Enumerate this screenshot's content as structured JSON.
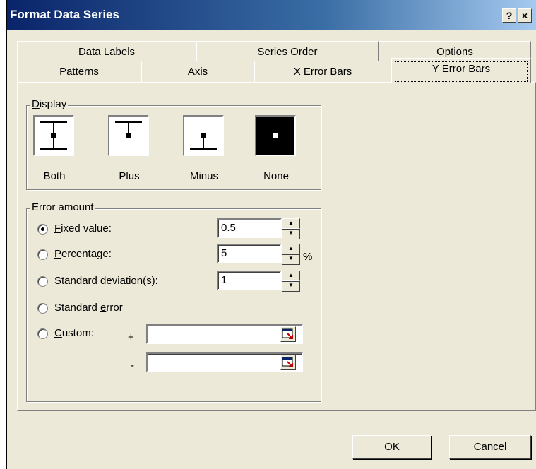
{
  "window": {
    "title": "Format Data Series",
    "help_glyph": "?",
    "close_glyph": "×"
  },
  "tabs": {
    "back_row": [
      "Data Labels",
      "Series Order",
      "Options"
    ],
    "front_row": [
      "Patterns",
      "Axis",
      "X Error Bars",
      "Y Error Bars"
    ],
    "active": "Y Error Bars"
  },
  "display": {
    "legend": "Display",
    "options": [
      {
        "label": "Both",
        "icon": "error-bar-both-icon"
      },
      {
        "label": "Plus",
        "icon": "error-bar-plus-icon"
      },
      {
        "label": "Minus",
        "icon": "error-bar-minus-icon"
      },
      {
        "label": "None",
        "icon": "error-bar-none-icon"
      }
    ],
    "selected": "None"
  },
  "error_amount": {
    "legend": "Error amount",
    "fixed_value": {
      "label": "Fixed value:",
      "value": "0.5",
      "selected": true
    },
    "percentage": {
      "label": "Percentage:",
      "value": "5",
      "unit": "%"
    },
    "standard_deviation": {
      "label": "Standard deviation(s):",
      "value": "1"
    },
    "standard_error": {
      "label": "Standard error"
    },
    "custom": {
      "label": "Custom:",
      "plus_sign": "+",
      "minus_sign": "-",
      "plus_value": "",
      "minus_value": ""
    }
  },
  "buttons": {
    "ok": "OK",
    "cancel": "Cancel"
  }
}
